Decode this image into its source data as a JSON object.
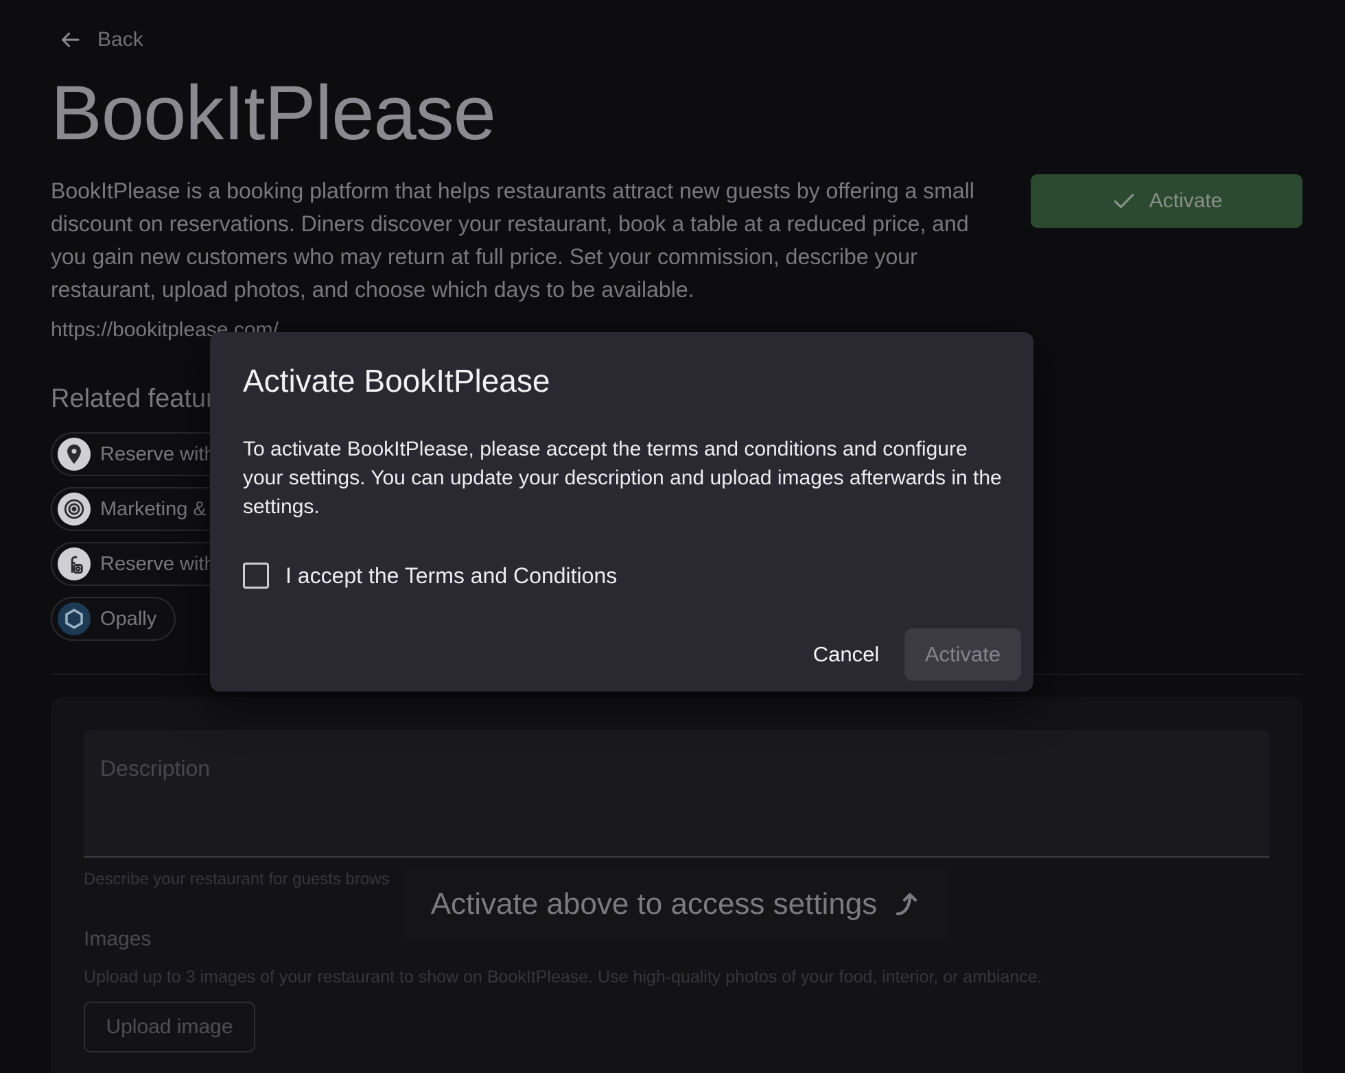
{
  "page": {
    "back_label": "Back",
    "title": "BookItPlease",
    "description": "BookItPlease is a booking platform that helps restaurants attract new guests by offering a small discount on reservations. Diners discover your restaurant, book a table at a reduced price, and you gain new customers who may return at full price. Set your commission, describe your restaurant, upload photos, and choose which days to be available.",
    "url": "https://bookitplease.com/",
    "activate_label": "Activate"
  },
  "related": {
    "heading": "Related featur",
    "items": [
      {
        "label": "Reserve with",
        "icon": "map-pin-icon",
        "icon_bg": "#cfcfd4"
      },
      {
        "label": "Marketing & A",
        "icon": "target-icon",
        "icon_bg": "#cfcfd4"
      },
      {
        "label": "Reserve with",
        "icon": "facebook-instagram-icon",
        "icon_bg": "#cfcfd4"
      },
      {
        "label": "Opally",
        "icon": "hexagon-icon",
        "icon_bg": "#1d3a55"
      }
    ]
  },
  "settings": {
    "description_placeholder": "Description",
    "description_help": "Describe your restaurant for guests brows",
    "images_label": "Images",
    "images_help": "Upload up to 3 images of your restaurant to show on BookItPlease. Use high-quality photos of your food, interior, or ambiance.",
    "upload_label": "Upload image",
    "locked_message": "Activate above to access settings"
  },
  "modal": {
    "title": "Activate BookItPlease",
    "body": "To activate BookItPlease, please accept the terms and conditions and configure your settings. You can update your description and upload images afterwards in the settings.",
    "terms_label": "I accept the Terms and Conditions",
    "terms_checked": false,
    "cancel_label": "Cancel",
    "activate_label": "Activate"
  },
  "colors": {
    "background": "#0d0d10",
    "modal_bg": "#2a2931",
    "activate_green": "#2b4a2f"
  }
}
